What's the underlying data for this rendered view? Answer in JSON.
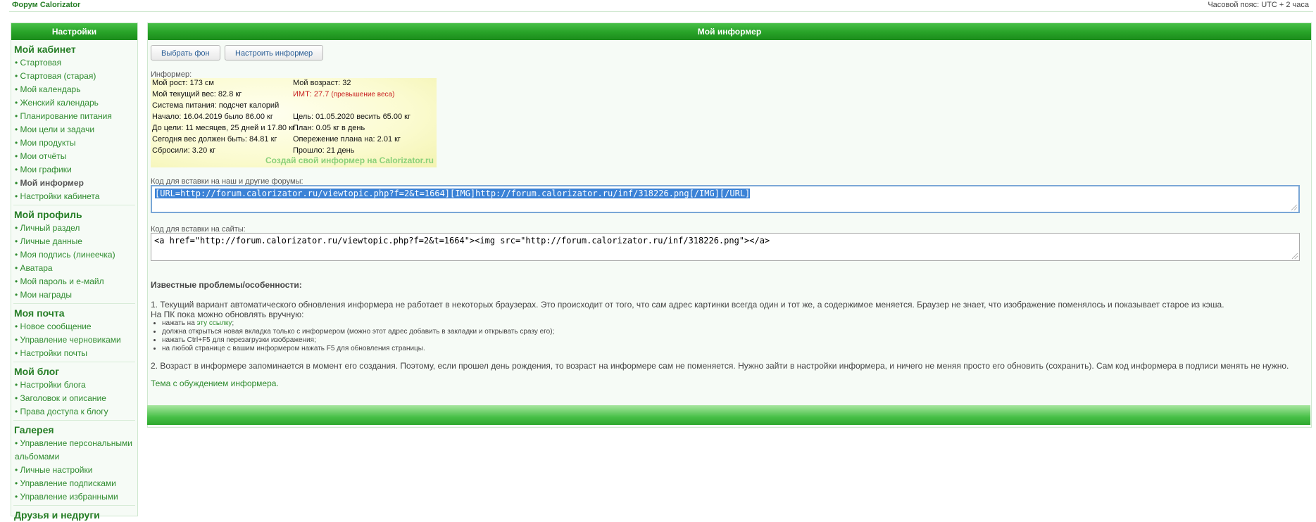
{
  "topbar": {
    "brand": "Форум Calorizator",
    "timezone": "Часовой пояс: UTC + 2 часа"
  },
  "sidebar": {
    "header": "Настройки",
    "sections": [
      {
        "title": "Мой кабинет",
        "items": [
          {
            "label": "Стартовая"
          },
          {
            "label": "Стартовая (старая)"
          },
          {
            "label": "Мой календарь"
          },
          {
            "label": "Женский календарь"
          },
          {
            "label": "Планирование питания"
          },
          {
            "label": "Мои цели и задачи"
          },
          {
            "label": "Мои продукты"
          },
          {
            "label": "Мои отчёты"
          },
          {
            "label": "Мои графики"
          },
          {
            "label": "Мой информер",
            "active": true
          },
          {
            "label": "Настройки кабинета"
          }
        ]
      },
      {
        "title": "Мой профиль",
        "items": [
          {
            "label": "Личный раздел"
          },
          {
            "label": "Личные данные"
          },
          {
            "label": "Моя подпись (линеечка)"
          },
          {
            "label": "Аватара"
          },
          {
            "label": "Мой пароль и e-майл"
          },
          {
            "label": "Мои награды"
          }
        ]
      },
      {
        "title": "Моя почта",
        "items": [
          {
            "label": "Новое сообщение"
          },
          {
            "label": "Управление черновиками"
          },
          {
            "label": "Настройки почты"
          }
        ]
      },
      {
        "title": "Мой блог",
        "items": [
          {
            "label": "Настройки блога"
          },
          {
            "label": "Заголовок и описание"
          },
          {
            "label": "Права доступа к блогу"
          }
        ]
      },
      {
        "title": "Галерея",
        "items": [
          {
            "label": "Управление персональными альбомами"
          },
          {
            "label": "Личные настройки"
          },
          {
            "label": "Управление подписками"
          },
          {
            "label": "Управление избранными"
          }
        ]
      },
      {
        "title": "Друзья и недруги",
        "items": []
      }
    ]
  },
  "main": {
    "header": "Мой информер",
    "buttons": {
      "choose_bg": "Выбрать фон",
      "configure": "Настроить информер"
    },
    "informer_label": "Информер:",
    "informer": {
      "height": "Мой рост: 173 см",
      "age": "Мой возраст: 32",
      "weight": "Мой текущий вес: 82.8 кг",
      "bmi": "ИМТ: 27.7",
      "bmi_note": "(превышение веса)",
      "system": "Система питания: подсчет калорий",
      "start": "Начало: 16.04.2019 было 86.00 кг",
      "goal": "Цель: 01.05.2020 весить 65.00 кг",
      "to_goal": "До цели: 11 месяцев, 25 дней и 17.80 кг",
      "plan": "План: 0.05 кг в день",
      "today": "Сегодня вес должен быть: 84.81 кг",
      "ahead": "Опережение плана на: 2.01 кг",
      "lost": "Сбросили: 3.20 кг",
      "passed": "Прошло: 21 день",
      "advert": "Создай свой информер на Calorizator.ru"
    },
    "forum_code_label": "Код для вставки на наш и другие форумы:",
    "forum_code": "[URL=http://forum.calorizator.ru/viewtopic.php?f=2&t=1664][IMG]http://forum.calorizator.ru/inf/318226.png[/IMG][/URL]",
    "site_code_label": "Код для вставки на сайты:",
    "site_code": "<a href=\"http://forum.calorizator.ru/viewtopic.php?f=2&t=1664\"><img src=\"http://forum.calorizator.ru/inf/318226.png\"></a>",
    "issues": {
      "title": "Известные проблемы/особенности:",
      "p1": "1. Текущий вариант автоматического обновления информера не работает в некоторых браузерах. Это происходит от того, что сам адрес картинки всегда один и тот же, а содержимое меняется. Браузер не знает, что изображение поменялось и показывает старое из кэша.",
      "p1b": "На ПК пока можно обновлять вручную:",
      "li1_pre": "нажать на ",
      "li1_link": "эту ссылку",
      "li1_post": ";",
      "li2": "должна открыться новая вкладка только с информером (можно этот адрес добавить в закладки и открывать сразу его);",
      "li3": "нажать Ctrl+F5 для перезагрузки изображения;",
      "li4": "на любой странице с вашим информером нажать F5 для обновления страницы.",
      "p2": "2. Возраст в информере запоминается в момент его создания. Поэтому, если прошел день рождения, то возраст на информере сам не поменяется. Нужно зайти в настройки информера, и ничего не меняя просто его обновить (сохранить). Сам код информера в подписи менять не нужно.",
      "topic_link": "Тема с обуждением информера."
    }
  }
}
